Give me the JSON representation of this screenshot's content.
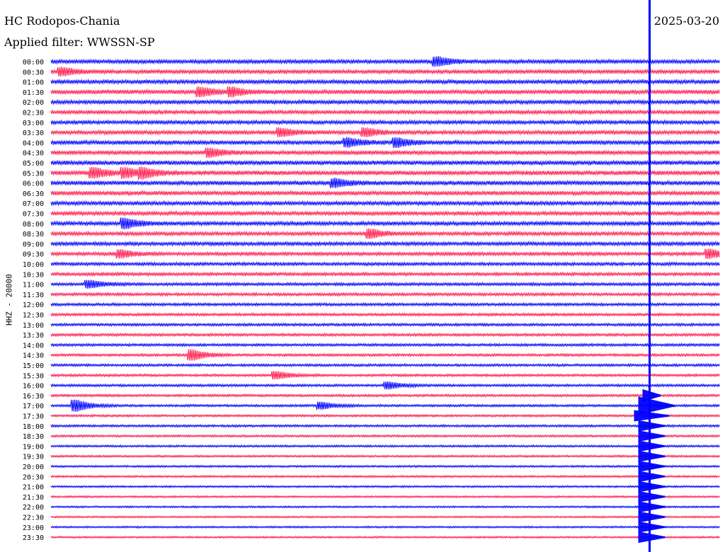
{
  "header": {
    "station": "HC Rodopos-Chania",
    "date": "2025-03-20",
    "filter": "Applied filter: WWSSN-SP"
  },
  "chart_data": {
    "type": "line",
    "kind": "helicorder",
    "title": "HC Rodopos-Chania",
    "date": "2025-03-20",
    "ylabel": "HHZ - 20000",
    "row_minutes": 15,
    "colors": [
      "#0000ff",
      "#ff1a4f"
    ],
    "row_labels": [
      "00:00",
      "00:30",
      "01:00",
      "01:30",
      "02:00",
      "02:30",
      "03:00",
      "03:30",
      "04:00",
      "04:30",
      "05:00",
      "05:30",
      "06:00",
      "06:30",
      "07:00",
      "07:30",
      "08:00",
      "08:30",
      "09:00",
      "09:30",
      "10:00",
      "10:30",
      "11:00",
      "11:30",
      "12:00",
      "12:30",
      "13:00",
      "13:30",
      "14:00",
      "14:30",
      "15:00",
      "15:30",
      "16:00",
      "16:30",
      "17:00",
      "17:30",
      "18:00",
      "18:30",
      "19:00",
      "19:30",
      "20:00",
      "20:30",
      "21:00",
      "21:30",
      "22:00",
      "22:30",
      "23:00",
      "23:30"
    ],
    "noise_by_row": [
      0.85,
      0.85,
      0.85,
      0.9,
      0.85,
      0.8,
      0.8,
      0.85,
      0.9,
      0.9,
      0.95,
      1.0,
      0.95,
      0.9,
      0.85,
      0.85,
      0.85,
      0.8,
      0.8,
      0.75,
      0.7,
      0.7,
      0.65,
      0.65,
      0.62,
      0.6,
      0.6,
      0.6,
      0.58,
      0.58,
      0.56,
      0.56,
      0.55,
      0.55,
      0.52,
      0.5,
      0.5,
      0.48,
      0.46,
      0.46,
      0.45,
      0.45,
      0.42,
      0.42,
      0.4,
      0.4,
      0.4,
      0.4
    ],
    "event": {
      "minute_in_row": 13.42,
      "label": ""
    },
    "bursts": [
      {
        "row": 0,
        "minute": 8.7,
        "amp": 1.6
      },
      {
        "row": 1,
        "minute": 0.3,
        "amp": 1.4
      },
      {
        "row": 3,
        "minute": 3.4,
        "amp": 1.6
      },
      {
        "row": 3,
        "minute": 4.1,
        "amp": 1.4
      },
      {
        "row": 7,
        "minute": 5.2,
        "amp": 1.4
      },
      {
        "row": 7,
        "minute": 7.1,
        "amp": 1.4
      },
      {
        "row": 8,
        "minute": 6.7,
        "amp": 1.5
      },
      {
        "row": 8,
        "minute": 7.8,
        "amp": 1.5
      },
      {
        "row": 9,
        "minute": 3.6,
        "amp": 1.5
      },
      {
        "row": 11,
        "minute": 1.0,
        "amp": 1.7
      },
      {
        "row": 11,
        "minute": 1.7,
        "amp": 1.5
      },
      {
        "row": 11,
        "minute": 2.1,
        "amp": 1.5
      },
      {
        "row": 12,
        "minute": 6.4,
        "amp": 1.4
      },
      {
        "row": 16,
        "minute": 1.7,
        "amp": 1.8
      },
      {
        "row": 17,
        "minute": 7.2,
        "amp": 1.6
      },
      {
        "row": 19,
        "minute": 1.6,
        "amp": 1.4
      },
      {
        "row": 19,
        "minute": 14.8,
        "amp": 1.6
      },
      {
        "row": 22,
        "minute": 0.9,
        "amp": 1.4
      },
      {
        "row": 29,
        "minute": 3.2,
        "amp": 2.0
      },
      {
        "row": 31,
        "minute": 5.1,
        "amp": 1.4
      },
      {
        "row": 32,
        "minute": 7.6,
        "amp": 1.3
      },
      {
        "row": 34,
        "minute": 0.6,
        "amp": 2.2
      },
      {
        "row": 34,
        "minute": 6.1,
        "amp": 1.3
      }
    ]
  }
}
